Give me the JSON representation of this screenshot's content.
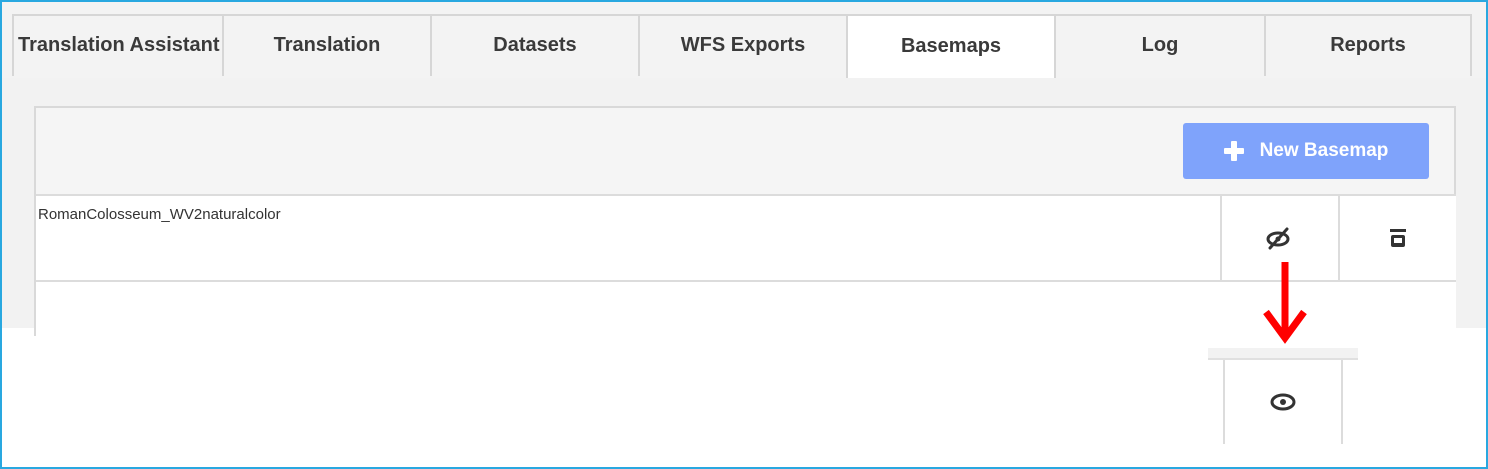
{
  "tabs": [
    {
      "label": "Translation Assistant"
    },
    {
      "label": "Translation"
    },
    {
      "label": "Datasets"
    },
    {
      "label": "WFS Exports"
    },
    {
      "label": "Basemaps",
      "active": true
    },
    {
      "label": "Log"
    },
    {
      "label": "Reports"
    }
  ],
  "toolbar": {
    "new_button_label": "New Basemap",
    "new_button_icon": "plus-icon"
  },
  "basemaps": [
    {
      "name": "RomanColosseum_WV2naturalcolor",
      "visibility_icon": "eye-slash-icon",
      "delete_icon": "trash-icon"
    }
  ],
  "callout": {
    "arrow_icon": "arrow-down-icon",
    "result_icon": "eye-icon"
  },
  "colors": {
    "frame": "#29a8e0",
    "button": "#7fa3fb",
    "arrow": "#ff0000",
    "icon": "#333333"
  }
}
